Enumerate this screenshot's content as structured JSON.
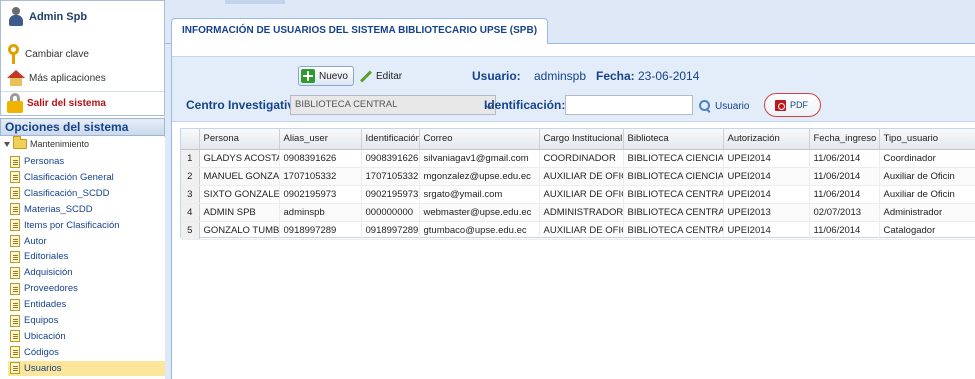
{
  "user_box": {
    "name": "Admin Spb",
    "change_password": "Cambiar clave",
    "more_apps": "Más aplicaciones",
    "logout": "Salir del sistema"
  },
  "sidebar": {
    "title": "Opciones del sistema",
    "root": "Mantenimiento",
    "items": [
      {
        "label": "Personas"
      },
      {
        "label": "Clasificación General"
      },
      {
        "label": "Clasificación_SCDD"
      },
      {
        "label": "Materias_SCDD"
      },
      {
        "label": "Items por Clasificación"
      },
      {
        "label": "Autor"
      },
      {
        "label": "Editoriales"
      },
      {
        "label": "Adquisición"
      },
      {
        "label": "Proveedores"
      },
      {
        "label": "Entidades"
      },
      {
        "label": "Equipos"
      },
      {
        "label": "Ubicación"
      },
      {
        "label": "Códigos"
      },
      {
        "label": "Usuarios"
      }
    ],
    "selected": "Usuarios"
  },
  "tab": {
    "title": "INFORMACIÓN DE USUARIOS DEL SISTEMA BIBLIOTECARIO UPSE (SPB)"
  },
  "toolbar": {
    "nuevo": "Nuevo",
    "editar": "Editar",
    "usuario_label": "Usuario:",
    "usuario_value": "adminspb",
    "fecha_label": "Fecha:",
    "fecha_value": "23-06-2014",
    "centro_label": "Centro Investigativo:",
    "centro_value": "BIBLIOTECA CENTRAL",
    "identificacion_label": "Identificación:",
    "identificacion_value": "",
    "usuario_button": "Usuario",
    "pdf_button": "PDF"
  },
  "grid": {
    "columns": [
      "Persona",
      "Alias_user",
      "Identificación",
      "Correo",
      "Cargo Institucional",
      "Biblioteca",
      "Autorización",
      "Fecha_ingreso",
      "Tipo_usuario"
    ],
    "rows": [
      [
        "1",
        "GLADYS ACOSTA",
        "0908391626",
        "0908391626",
        "silvaniagav1@gmail.com",
        "COORDINADOR",
        "BIBLIOTECA CIENCIAS",
        "UPEI2014",
        "11/06/2014",
        "Coordinador"
      ],
      [
        "2",
        "MANUEL GONZALE",
        "1707105332",
        "1707105332",
        "mgonzalez@upse.edu.ec",
        "AUXILIAR DE OFICI",
        "BIBLIOTECA CIENCIAS",
        "UPEI2014",
        "11/06/2014",
        "Auxiliar de Oficin"
      ],
      [
        "3",
        "SIXTO GONZALEZ",
        "0902195973",
        "0902195973",
        "srgato@ymail.com",
        "AUXILIAR DE OFICI",
        "BIBLIOTECA CENTRAL",
        "UPEI2014",
        "11/06/2014",
        "Auxiliar de Oficin"
      ],
      [
        "4",
        "ADMIN SPB",
        "adminspb",
        "000000000",
        "webmaster@upse.edu.ec",
        "ADMINISTRADOR",
        "BIBLIOTECA CENTRAL",
        "UPEI2013",
        "02/07/2013",
        "Administrador"
      ],
      [
        "5",
        "GONZALO TUMBA(",
        "0918997289",
        "0918997289",
        "gtumbaco@upse.edu.ec",
        "AUXILIAR DE OFICI",
        "BIBLIOTECA CENTRAL",
        "UPEI2014",
        "11/06/2014",
        "Catalogador"
      ]
    ]
  }
}
